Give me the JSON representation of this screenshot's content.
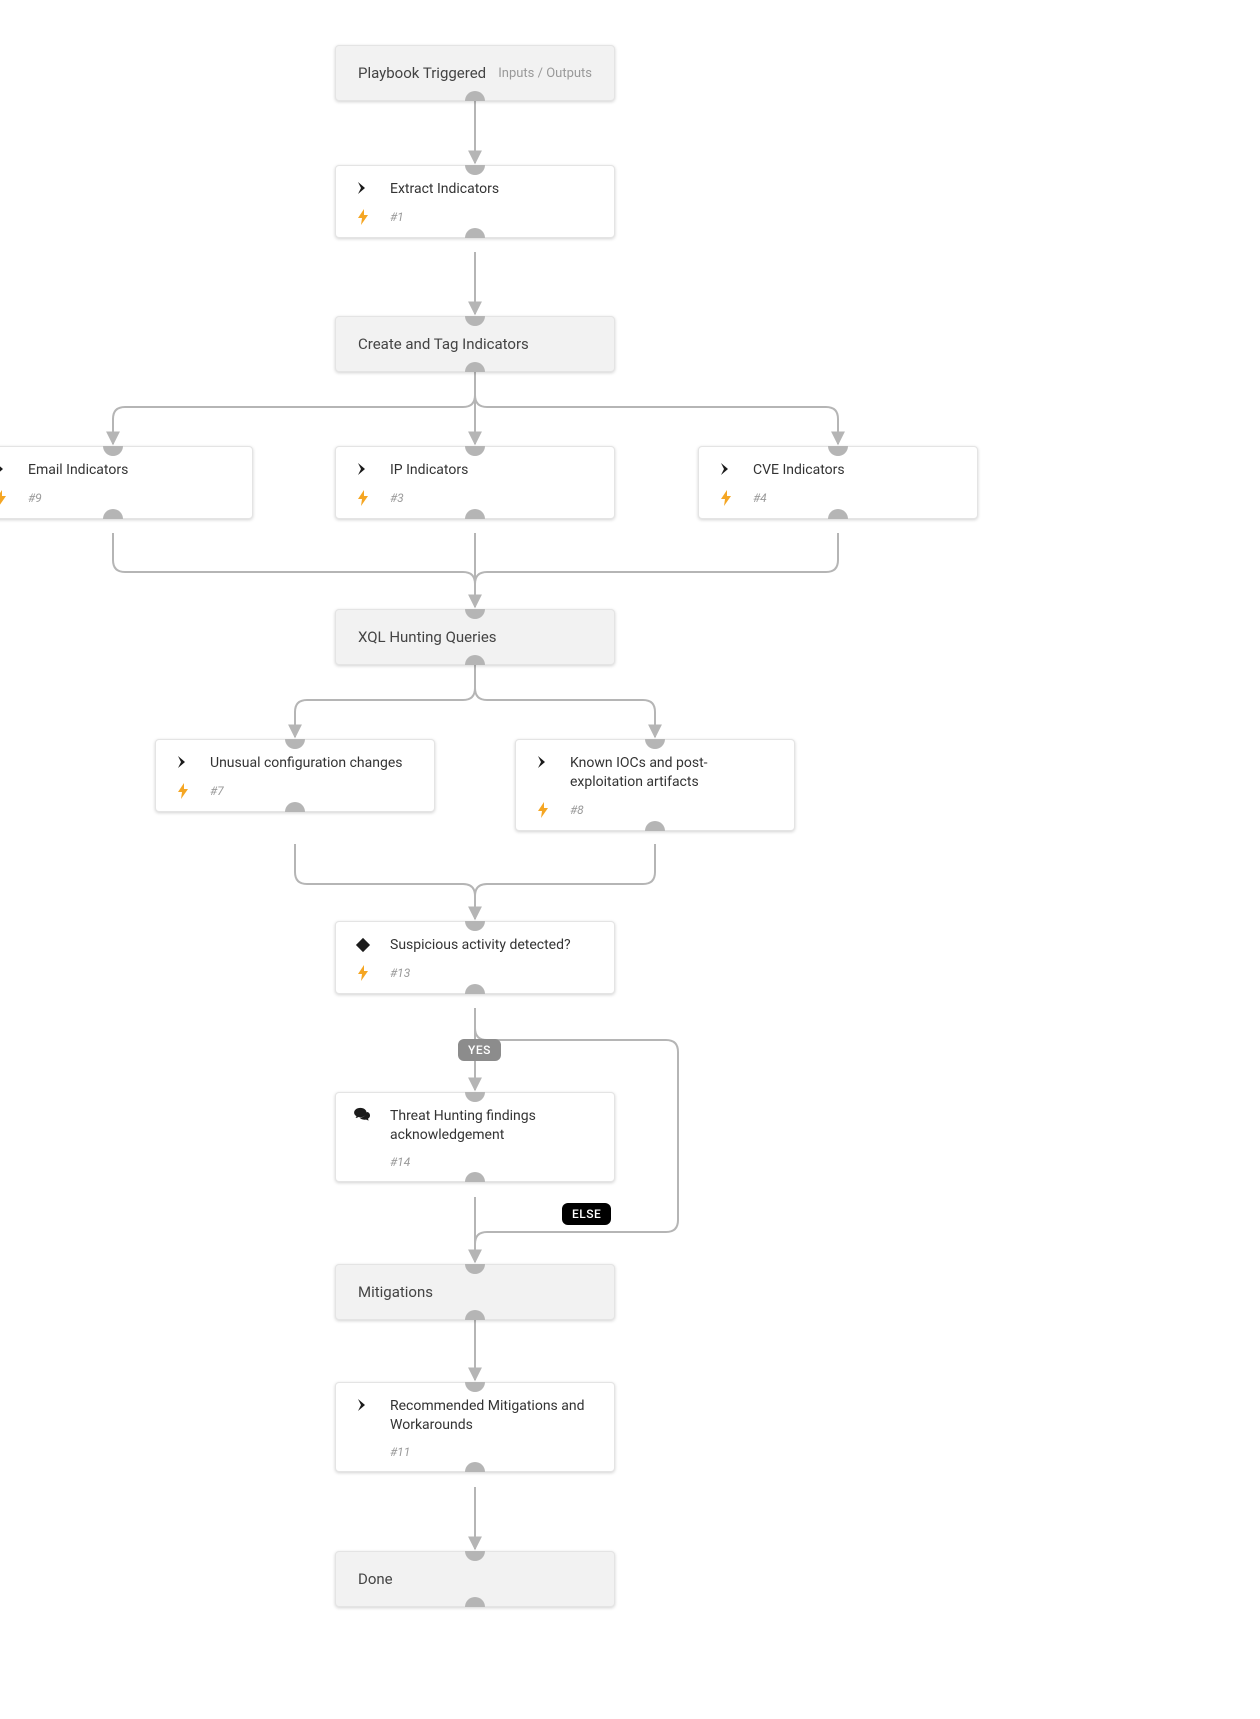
{
  "nodes": {
    "trigger": {
      "title": "Playbook Triggered",
      "subtext": "Inputs / Outputs"
    },
    "extract": {
      "title": "Extract Indicators",
      "num": "#1"
    },
    "createTag": {
      "title": "Create and Tag Indicators"
    },
    "email": {
      "title": "Email Indicators",
      "num": "#9"
    },
    "ip": {
      "title": "IP Indicators",
      "num": "#3"
    },
    "cve": {
      "title": "CVE Indicators",
      "num": "#4"
    },
    "xql": {
      "title": "XQL Hunting Queries"
    },
    "unusual": {
      "title": "Unusual configuration changes",
      "num": "#7"
    },
    "ioc": {
      "title": "Known IOCs and post-exploitation artifacts",
      "num": "#8"
    },
    "suspicious": {
      "title": "Suspicious activity detected?",
      "num": "#13"
    },
    "threat": {
      "title": "Threat Hunting findings acknowledgement",
      "num": "#14"
    },
    "mitig": {
      "title": "Mitigations"
    },
    "recomm": {
      "title": "Recommended Mitigations and Workarounds",
      "num": "#11"
    },
    "done": {
      "title": "Done"
    }
  },
  "badges": {
    "yes": "YES",
    "else": "ELSE"
  }
}
